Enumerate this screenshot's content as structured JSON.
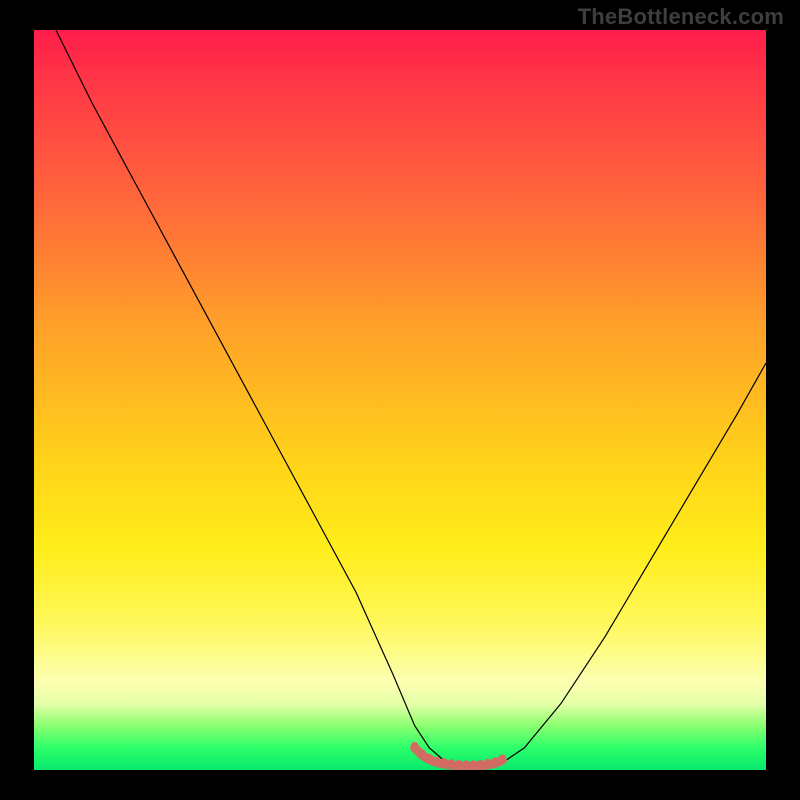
{
  "watermark": "TheBottleneck.com",
  "colors": {
    "curve_stroke": "#000000",
    "bottom_highlight_stroke": "#d46b63",
    "bottom_highlight_fill": "#d46b63",
    "plot_outline": "#000000"
  },
  "chart_data": {
    "type": "line",
    "title": "",
    "xlabel": "",
    "ylabel": "",
    "xlim": [
      0,
      100
    ],
    "ylim": [
      0,
      100
    ],
    "series": [
      {
        "name": "bottleneck-curve",
        "x": [
          3,
          8,
          14,
          20,
          26,
          32,
          38,
          44,
          49,
          52,
          54,
          56,
          58,
          60,
          62,
          64,
          67,
          72,
          78,
          84,
          90,
          96,
          100
        ],
        "y": [
          100,
          90,
          79,
          68,
          57,
          46,
          35,
          24,
          13,
          6,
          3,
          1.3,
          0.7,
          0.5,
          0.6,
          1.0,
          3,
          9,
          18,
          28,
          38,
          48,
          55
        ]
      },
      {
        "name": "optimal-zone",
        "x": [
          52,
          53,
          54,
          55,
          56,
          57,
          58,
          59,
          60,
          61,
          62,
          63,
          64
        ],
        "y": [
          3.0,
          2.0,
          1.4,
          1.0,
          0.8,
          0.65,
          0.55,
          0.5,
          0.5,
          0.55,
          0.7,
          0.9,
          1.3
        ]
      }
    ],
    "annotations": [
      {
        "text": "TheBottleneck.com",
        "role": "watermark",
        "position": "top-right"
      }
    ]
  }
}
